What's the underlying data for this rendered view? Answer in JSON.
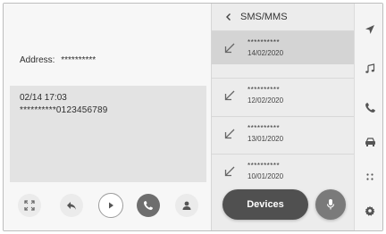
{
  "detail": {
    "address_label": "Address:",
    "address_value": "**********",
    "message_date": "02/14 17:03",
    "message_number": "**********0123456789"
  },
  "actions": [
    {
      "name": "expand-icon"
    },
    {
      "name": "reply-icon"
    },
    {
      "name": "play-icon"
    },
    {
      "name": "phone-icon"
    },
    {
      "name": "contact-icon"
    }
  ],
  "list": {
    "title": "SMS/MMS",
    "items": [
      {
        "name": "**********",
        "date": "14/02/2020",
        "selected": true
      },
      {
        "name": "**********",
        "date": "12/02/2020",
        "selected": false
      },
      {
        "name": "**********",
        "date": "13/01/2020",
        "selected": false
      },
      {
        "name": "**********",
        "date": "10/01/2020",
        "selected": false
      }
    ]
  },
  "bottom": {
    "devices_label": "Devices"
  },
  "rail": [
    {
      "name": "navigation-icon"
    },
    {
      "name": "music-icon"
    },
    {
      "name": "phone-icon",
      "active": true
    },
    {
      "name": "car-icon"
    },
    {
      "name": "apps-icon"
    },
    {
      "name": "settings-icon"
    }
  ],
  "colors": {
    "selected_row": "#d4d4d4",
    "devices_button": "#505050",
    "mic_button": "#7a7a7a",
    "call_button": "#6e6e6e"
  }
}
